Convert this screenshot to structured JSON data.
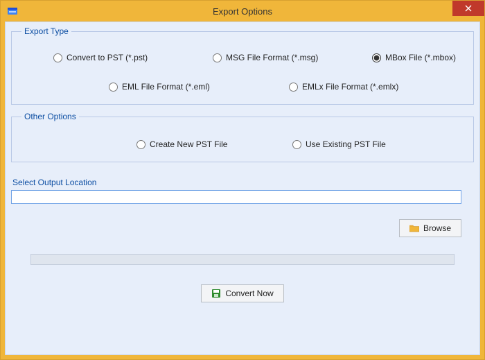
{
  "window": {
    "title": "Export Options"
  },
  "exportType": {
    "legend": "Export Type",
    "options": {
      "pst": "Convert to PST (*.pst)",
      "msg": "MSG File Format (*.msg)",
      "mbox": "MBox File (*.mbox)",
      "eml": "EML File Format (*.eml)",
      "emlx": "EMLx File Format (*.emlx)"
    },
    "selected": "mbox"
  },
  "otherOptions": {
    "legend": "Other Options",
    "options": {
      "createNew": "Create  New  PST  File",
      "useExisting": "Use Existing PST File"
    }
  },
  "output": {
    "label": "Select Output Location",
    "value": "",
    "browse": "Browse"
  },
  "convert": {
    "label": "Convert Now"
  }
}
